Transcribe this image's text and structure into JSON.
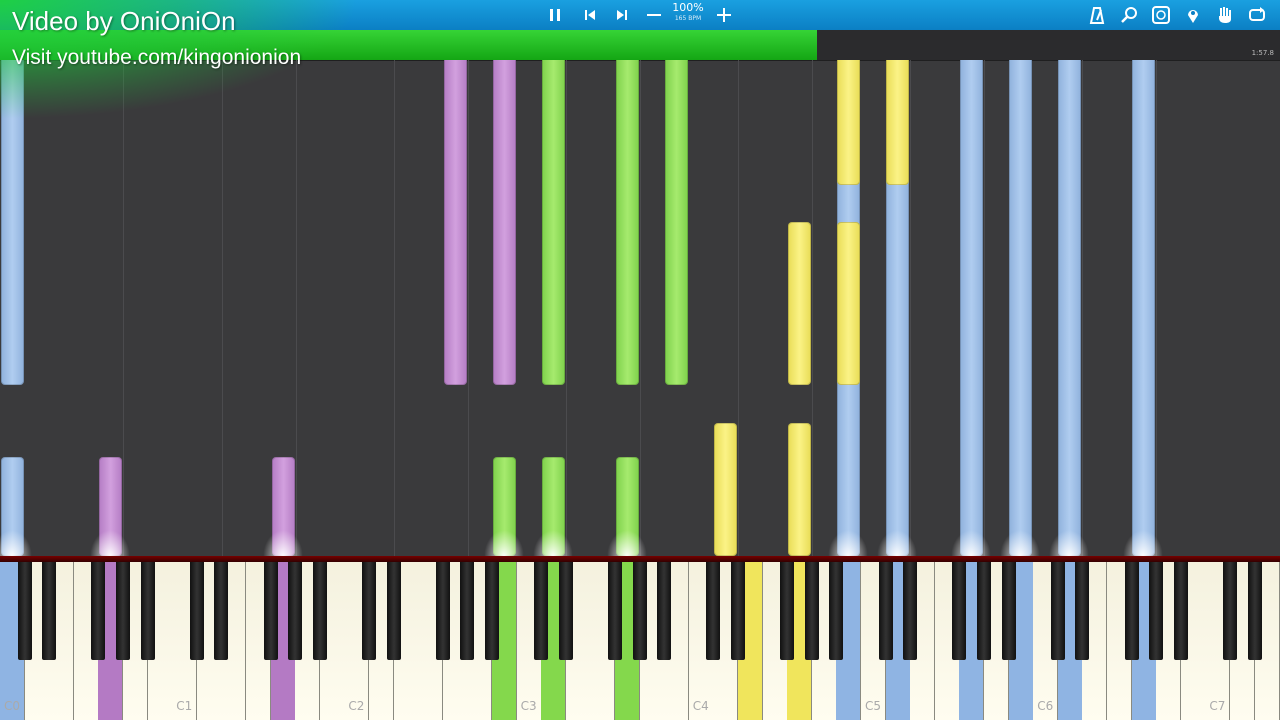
{
  "toolbar": {
    "pause_icon": "pause-icon",
    "prev_icon": "skip-back-icon",
    "next_icon": "skip-forward-icon",
    "minus_icon": "minus-icon",
    "plus_icon": "plus-icon",
    "zoom": "100%",
    "bpm": "165 BPM",
    "right_icons": [
      "metronome-icon",
      "search-icon",
      "keyboard-settings-icon",
      "map-pin-icon",
      "hand-icon",
      "loop-icon"
    ]
  },
  "progress": {
    "fraction": 0.638,
    "time": "1:57.8"
  },
  "overlay": {
    "credit": "Video by OniOniOn",
    "visit": "Visit youtube.com/kingonionion"
  },
  "keyboard": {
    "octave_labels": [
      "C0",
      "C1",
      "C2",
      "C3",
      "C4",
      "C5",
      "C6",
      "C7"
    ]
  },
  "colors": {
    "blue": "#9dbde6",
    "purple": "#c48ed2",
    "green": "#92df5c",
    "yellow": "#f3eb70",
    "toolbar": "#1098d6",
    "progress": "#22c022"
  }
}
